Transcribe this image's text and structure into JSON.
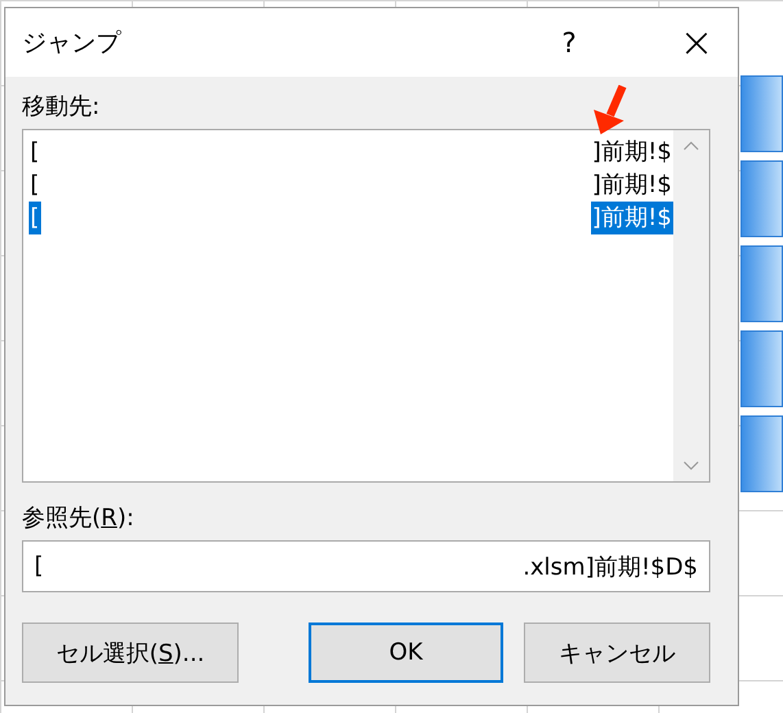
{
  "window": {
    "title": "ジャンプ",
    "help": "?",
    "close": "×"
  },
  "goto": {
    "label": "移動先:",
    "items": [
      {
        "start": "[",
        "end": "]前期!$",
        "selected": false
      },
      {
        "start": "[",
        "end": "]前期!$",
        "selected": false
      },
      {
        "start": "[",
        "end": "]前期!$",
        "selected": true
      }
    ]
  },
  "reference": {
    "label": {
      "before": "参照先(",
      "key": "R",
      "after": "):"
    },
    "value_start": "[",
    "value_end": ".xlsm]前期!$D$"
  },
  "buttons": [
    {
      "kind": "plain",
      "label": {
        "before": "セル選択(",
        "key": "S",
        "after": ")..."
      }
    },
    {
      "kind": "default",
      "label": {
        "before": "OK"
      }
    },
    {
      "kind": "plain",
      "label": {
        "before": "キャンセル"
      }
    }
  ]
}
